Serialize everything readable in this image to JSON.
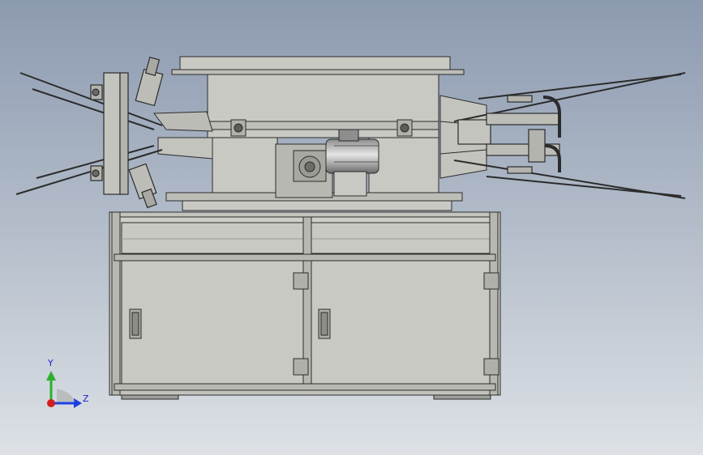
{
  "window": {
    "title": ""
  },
  "colors": {
    "background_top": "#8c9ab0",
    "background_bottom": "#dde1e6",
    "part_fill": "#c9c9c3",
    "part_fill_dark": "#b3b3ad",
    "edge": "#2b2b2b",
    "axis_x": "#d21f1f",
    "axis_y": "#2cb12c",
    "axis_z": "#1b3fe0"
  },
  "triad": {
    "y_label": "Y",
    "z_label": "Z"
  }
}
